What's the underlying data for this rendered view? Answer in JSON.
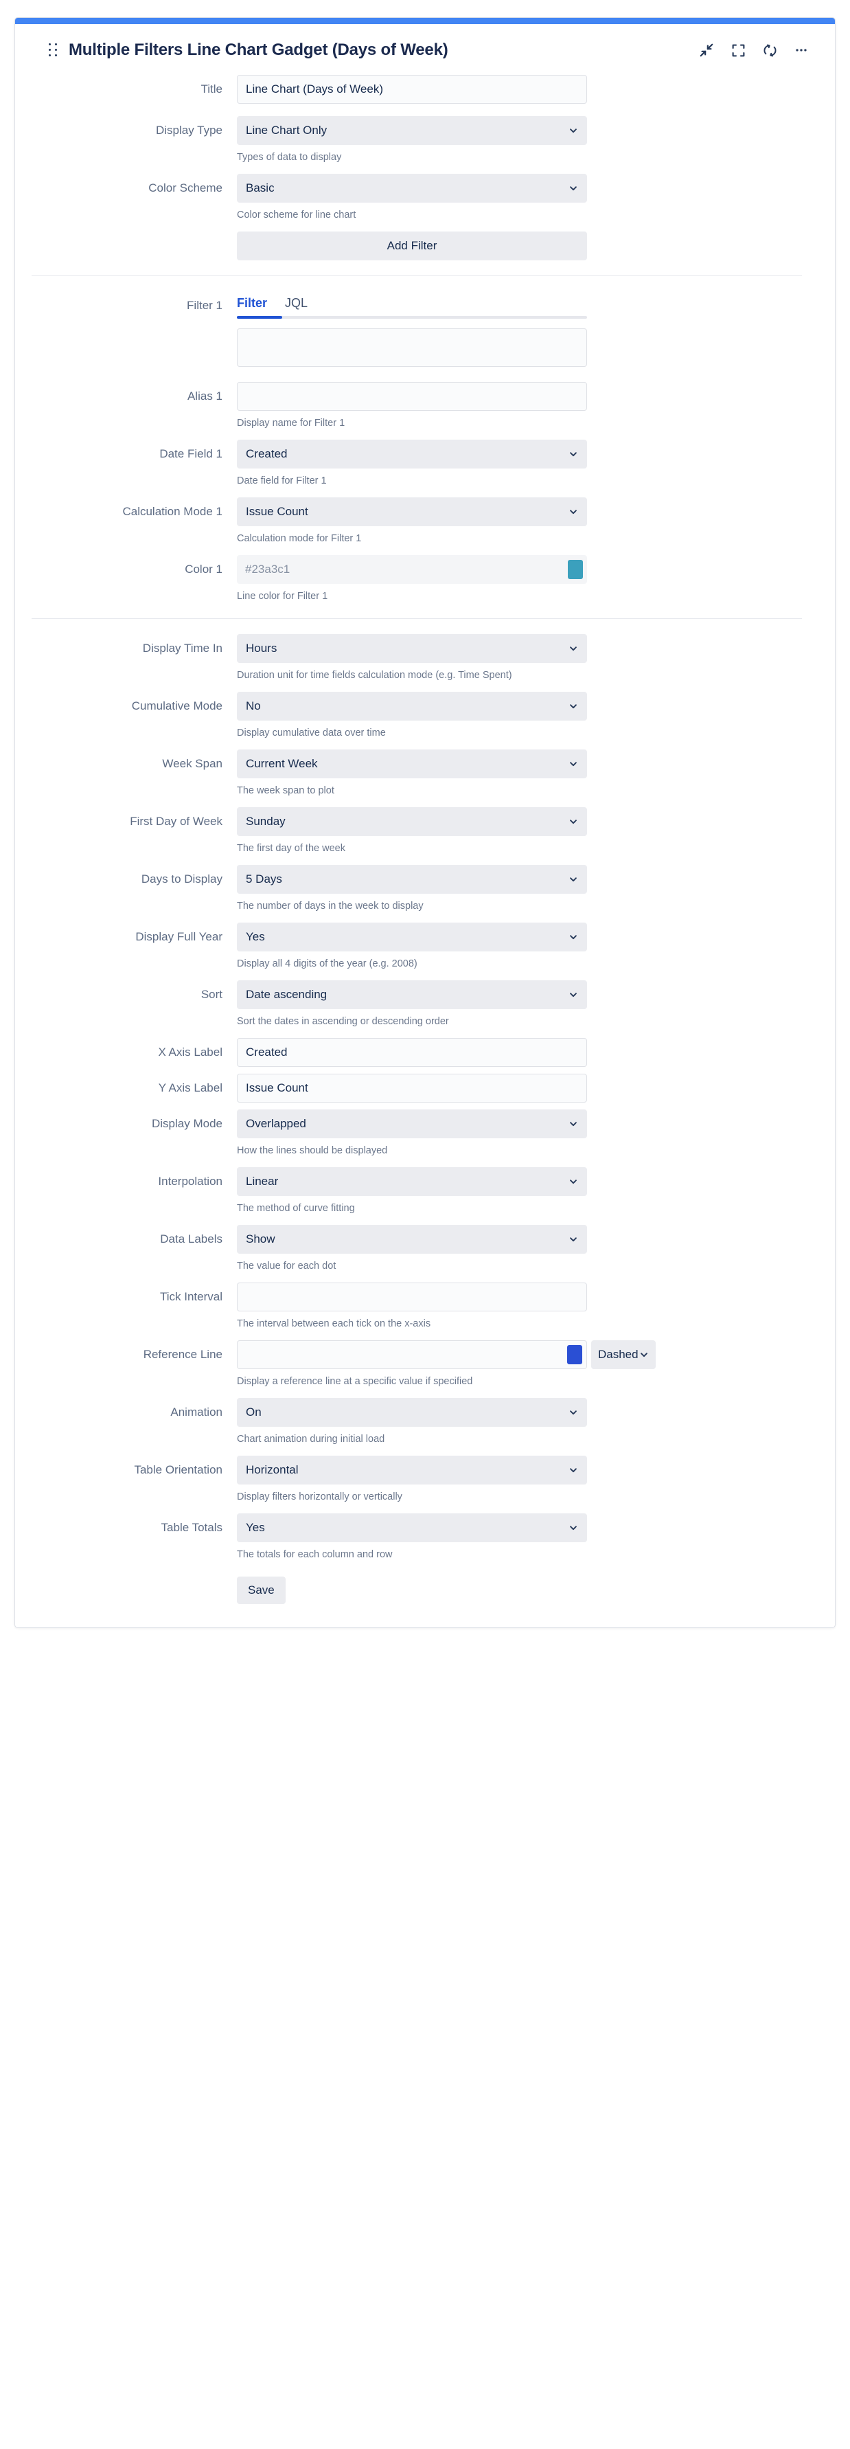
{
  "gadget": {
    "title": "Multiple Filters Line Chart Gadget (Days of Week)",
    "accent_color": "#4285f4",
    "header_icons": [
      {
        "name": "collapse-icon",
        "label": "Collapse"
      },
      {
        "name": "fullscreen-icon",
        "label": "Maximize"
      },
      {
        "name": "refresh-icon",
        "label": "Refresh"
      },
      {
        "name": "more-options-icon",
        "label": "More"
      }
    ]
  },
  "fields": {
    "title": {
      "label": "Title",
      "value": "Line Chart (Days of Week)",
      "placeholder": ""
    },
    "display_type": {
      "label": "Display Type",
      "value": "Line Chart Only",
      "helper": "Types of data to display"
    },
    "color_scheme": {
      "label": "Color Scheme",
      "value": "Basic",
      "helper": "Color scheme for line chart"
    },
    "add_filter": {
      "label": "Add Filter"
    },
    "filter_1": {
      "label": "Filter 1",
      "tabs": [
        {
          "label": "Filter",
          "active": true
        },
        {
          "label": "JQL",
          "active": false
        }
      ],
      "query_value": "",
      "query_placeholder": ""
    },
    "alias_1": {
      "label": "Alias 1",
      "value": "",
      "placeholder": "",
      "helper": "Display name for Filter 1"
    },
    "date_field_1": {
      "label": "Date Field 1",
      "value": "Created",
      "helper": "Date field for Filter 1"
    },
    "calculation_mode_1": {
      "label": "Calculation Mode 1",
      "value": "Issue Count",
      "helper": "Calculation mode for Filter 1"
    },
    "color_1": {
      "label": "Color 1",
      "value": "",
      "placeholder": "#23a3c1",
      "swatch": "#3ba0bd",
      "helper": "Line color for Filter 1"
    },
    "display_time_in": {
      "label": "Display Time In",
      "value": "Hours",
      "helper": "Duration unit for time fields calculation mode (e.g. Time Spent)"
    },
    "cumulative_mode": {
      "label": "Cumulative Mode",
      "value": "No",
      "helper": "Display cumulative data over time"
    },
    "week_span": {
      "label": "Week Span",
      "value": "Current Week",
      "helper": "The week span to plot"
    },
    "first_day_of_week": {
      "label": "First Day of Week",
      "value": "Sunday",
      "helper": "The first day of the week"
    },
    "days_to_display": {
      "label": "Days to Display",
      "value": "5 Days",
      "helper": "The number of days in the week to display"
    },
    "display_full_year": {
      "label": "Display Full Year",
      "value": "Yes",
      "helper": "Display all 4 digits of the year (e.g. 2008)"
    },
    "sort": {
      "label": "Sort",
      "value": "Date ascending",
      "helper": "Sort the dates in ascending or descending order"
    },
    "x_axis_label": {
      "label": "X Axis Label",
      "value": "Created",
      "placeholder": ""
    },
    "y_axis_label": {
      "label": "Y Axis Label",
      "value": "Issue Count",
      "placeholder": ""
    },
    "display_mode": {
      "label": "Display Mode",
      "value": "Overlapped",
      "helper": "How the lines should be displayed"
    },
    "interpolation": {
      "label": "Interpolation",
      "value": "Linear",
      "helper": "The method of curve fitting"
    },
    "data_labels": {
      "label": "Data Labels",
      "value": "Show",
      "helper": "The value for each dot"
    },
    "tick_interval": {
      "label": "Tick Interval",
      "value": "",
      "placeholder": "",
      "helper": "The interval between each tick on the x-axis"
    },
    "reference_line": {
      "label": "Reference Line",
      "value": "",
      "placeholder": "",
      "swatch": "#2a4fd4",
      "style_value": "Dashed",
      "helper": "Display a reference line at a specific value if specified"
    },
    "animation": {
      "label": "Animation",
      "value": "On",
      "helper": "Chart animation during initial load"
    },
    "table_orientation": {
      "label": "Table Orientation",
      "value": "Horizontal",
      "helper": "Display filters horizontally or vertically"
    },
    "table_totals": {
      "label": "Table Totals",
      "value": "Yes",
      "helper": "The totals for each column and row"
    },
    "save": {
      "label": "Save"
    }
  }
}
